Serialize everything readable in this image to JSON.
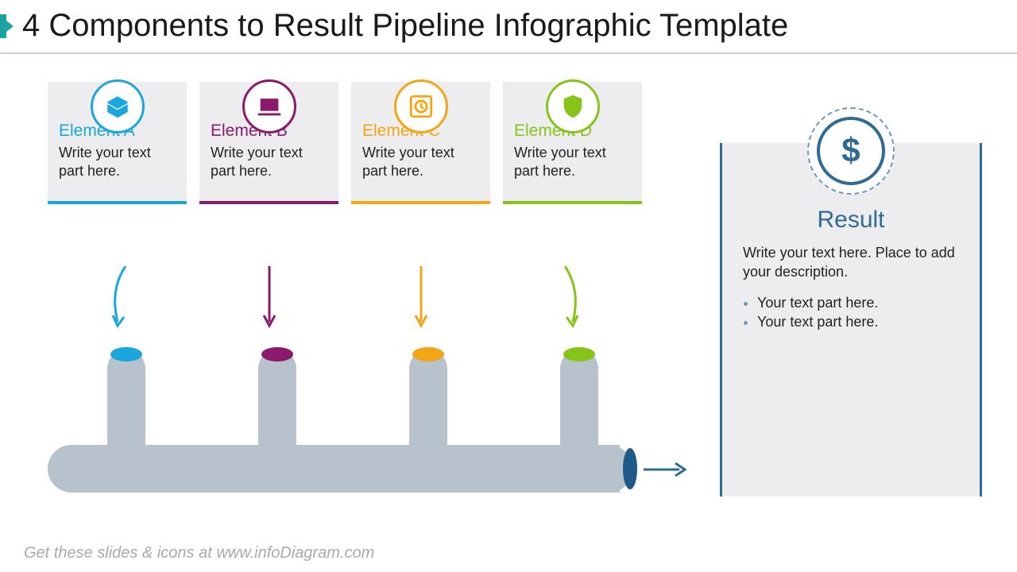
{
  "title": "4 Components to Result Pipeline Infographic Template",
  "elements": [
    {
      "label": "Element A",
      "body": "Write your text part here.",
      "icon": "box-icon",
      "color": "#1aa7dd"
    },
    {
      "label": "Element B",
      "body": "Write your text part here.",
      "icon": "laptop-icon",
      "color": "#8a1a6b"
    },
    {
      "label": "Element C",
      "body": "Write your text part here.",
      "icon": "clock-icon",
      "color": "#f2a516"
    },
    {
      "label": "Element D",
      "body": "Write your text part here.",
      "icon": "shield-icon",
      "color": "#87c41a"
    }
  ],
  "result": {
    "title": "Result",
    "body": "Write your text here. Place to add your description.",
    "bullets": [
      "Your text part here.",
      "Your text part here."
    ],
    "icon": "dollar-icon",
    "color": "#2f6b94"
  },
  "footer": "Get these slides & icons at www.infoDiagram.com"
}
